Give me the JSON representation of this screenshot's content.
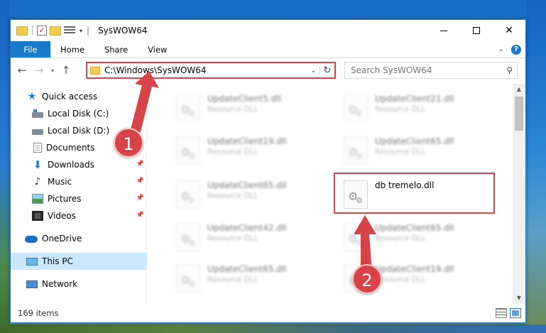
{
  "window": {
    "title": "SysWOW64",
    "title_separator": "|"
  },
  "window_controls": {
    "minimize": "—",
    "maximize": "☐",
    "close": "✕"
  },
  "ribbon": {
    "tabs": [
      {
        "label": "File",
        "active": true
      },
      {
        "label": "Home"
      },
      {
        "label": "Share"
      },
      {
        "label": "View"
      }
    ],
    "help": "?"
  },
  "navigation": {
    "address": "C:\\Windows\\SysWOW64",
    "search_placeholder": "Search SysWOW64"
  },
  "sidebar": {
    "items": [
      {
        "label": "Quick access",
        "icon": "star-icon"
      },
      {
        "label": "Local Disk (C:)",
        "icon": "local-disk-icon",
        "pinned": false
      },
      {
        "label": "Local Disk (D:)",
        "icon": "local-disk-icon",
        "pinned": false
      },
      {
        "label": "Documents",
        "icon": "documents-icon",
        "pinned": false
      },
      {
        "label": "Downloads",
        "icon": "downloads-icon",
        "pinned": true
      },
      {
        "label": "Music",
        "icon": "music-icon",
        "pinned": true
      },
      {
        "label": "Pictures",
        "icon": "pictures-icon",
        "pinned": true
      },
      {
        "label": "Videos",
        "icon": "videos-icon",
        "pinned": true
      },
      {
        "label": "OneDrive",
        "icon": "onedrive-icon"
      },
      {
        "label": "This PC",
        "icon": "this-pc-icon",
        "selected": true
      },
      {
        "label": "Network",
        "icon": "network-icon"
      }
    ]
  },
  "files": [
    {
      "name": "UpdateClient5.dll",
      "type": "Resource DLL",
      "blurred": true
    },
    {
      "name": "UpdateClient21.dll",
      "type": "Resource DLL",
      "blurred": true
    },
    {
      "name": "UpdateClient19.dll",
      "type": "Resource DLL",
      "blurred": true
    },
    {
      "name": "UpdateClient65.dll",
      "type": "Resource DLL",
      "blurred": true
    },
    {
      "name": "UpdateClient65.dll",
      "type": "Resource DLL",
      "blurred": true
    },
    {
      "name": "db tremelo.dll",
      "type": "",
      "blurred": false,
      "highlighted": true
    },
    {
      "name": "UpdateClient42.dll",
      "type": "Resource DLL",
      "blurred": true
    },
    {
      "name": "UpdateClient65.dll",
      "type": "Resource DLL",
      "blurred": true
    },
    {
      "name": "UpdateClient65.dll",
      "type": "Resource DLL",
      "blurred": true
    },
    {
      "name": "UpdateClient19.dll",
      "type": "Resource DLL",
      "blurred": true
    }
  ],
  "status": {
    "item_count": "169 items"
  },
  "annotations": {
    "step1": "1",
    "step2": "2",
    "color": "#d8434a"
  }
}
